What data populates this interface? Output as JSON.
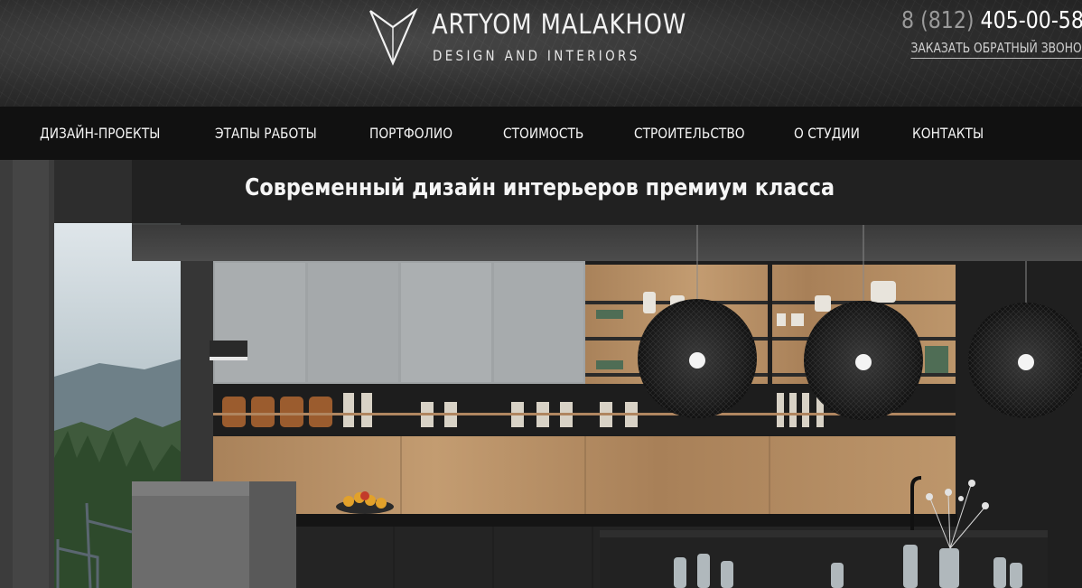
{
  "brand": {
    "name": "ARTYOM MALAKHOW",
    "tagline": "DESIGN AND INTERIORS"
  },
  "contact": {
    "phone_code": "8 (812)",
    "phone_number": "405-00-58",
    "callback_label": "ЗАКАЗАТЬ ОБРАТНЫЙ ЗВОНОК"
  },
  "nav": {
    "items": [
      {
        "label": "ДИЗАЙН-ПРОЕКТЫ"
      },
      {
        "label": "ЭТАПЫ РАБОТЫ"
      },
      {
        "label": "ПОРТФОЛИО"
      },
      {
        "label": "СТОИМОСТЬ"
      },
      {
        "label": "СТРОИТЕЛЬСТВО"
      },
      {
        "label": "О СТУДИИ"
      },
      {
        "label": "КОНТАКТЫ"
      }
    ]
  },
  "hero": {
    "headline": "Современный дизайн интерьеров премиум класса"
  },
  "colors": {
    "header_bg": "#2e2e2e",
    "nav_bg": "#111111",
    "text": "#ffffff",
    "muted": "#9a9a9a"
  }
}
